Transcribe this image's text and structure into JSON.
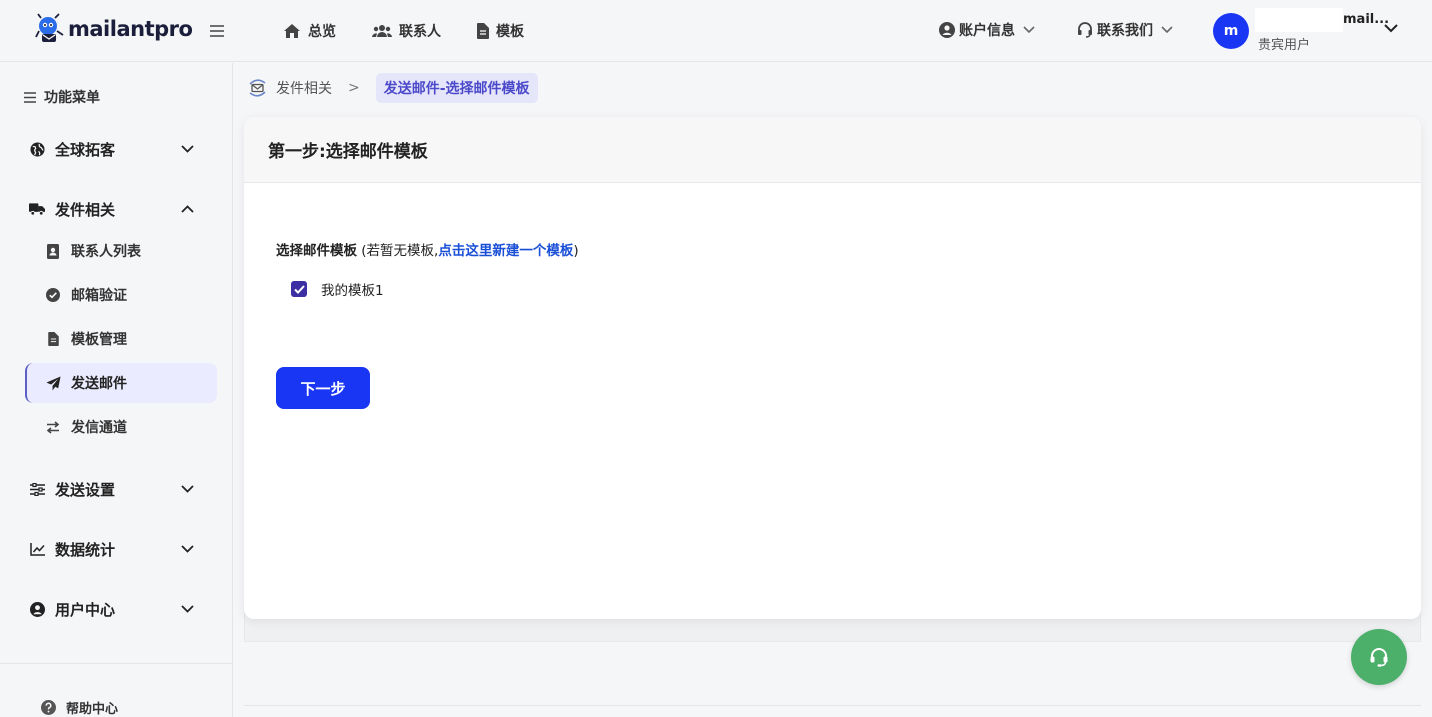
{
  "brand": {
    "name": "mailantpro"
  },
  "topnav": [
    {
      "label": "总览",
      "icon": "home-icon"
    },
    {
      "label": "联系人",
      "icon": "users-icon"
    },
    {
      "label": "模板",
      "icon": "file-icon"
    }
  ],
  "header": {
    "account_label": "账户信息",
    "contact_label": "联系我们",
    "user": {
      "avatar_letter": "m",
      "email": "mail...",
      "role": "贵宾用户"
    }
  },
  "sidebar": {
    "title": "功能菜单",
    "groups": [
      {
        "label": "全球拓客",
        "icon": "globe-icon",
        "expanded": false
      },
      {
        "label": "发件相关",
        "icon": "truck-icon",
        "expanded": true,
        "items": [
          {
            "label": "联系人列表",
            "icon": "contact-book-icon"
          },
          {
            "label": "邮箱验证",
            "icon": "check-circle-icon"
          },
          {
            "label": "模板管理",
            "icon": "file-icon"
          },
          {
            "label": "发送邮件",
            "icon": "paper-plane-icon",
            "active": true
          },
          {
            "label": "发信通道",
            "icon": "swap-arrows-icon"
          }
        ]
      },
      {
        "label": "发送设置",
        "icon": "sliders-icon",
        "expanded": false
      },
      {
        "label": "数据统计",
        "icon": "line-chart-icon",
        "expanded": false
      },
      {
        "label": "用户中心",
        "icon": "user-circle-icon",
        "expanded": false
      }
    ],
    "help_label": "帮助中心"
  },
  "breadcrumb": {
    "parent": "发件相关",
    "separator": ">",
    "current": "发送邮件-选择邮件模板"
  },
  "card": {
    "title": "第一步:选择邮件模板",
    "field_label": "选择邮件模板",
    "hint_prefix": " (若暂无模板,",
    "hint_link": "点击这里新建一个模板",
    "hint_suffix": ")",
    "templates": [
      {
        "name": "我的模板1",
        "checked": true
      }
    ],
    "next_button": "下一步"
  },
  "colors": {
    "primary": "#1a36f5",
    "active_bg": "#ebebff",
    "accent": "#5b5fc7",
    "link": "#1a4fd8",
    "support": "#4caf6a"
  }
}
